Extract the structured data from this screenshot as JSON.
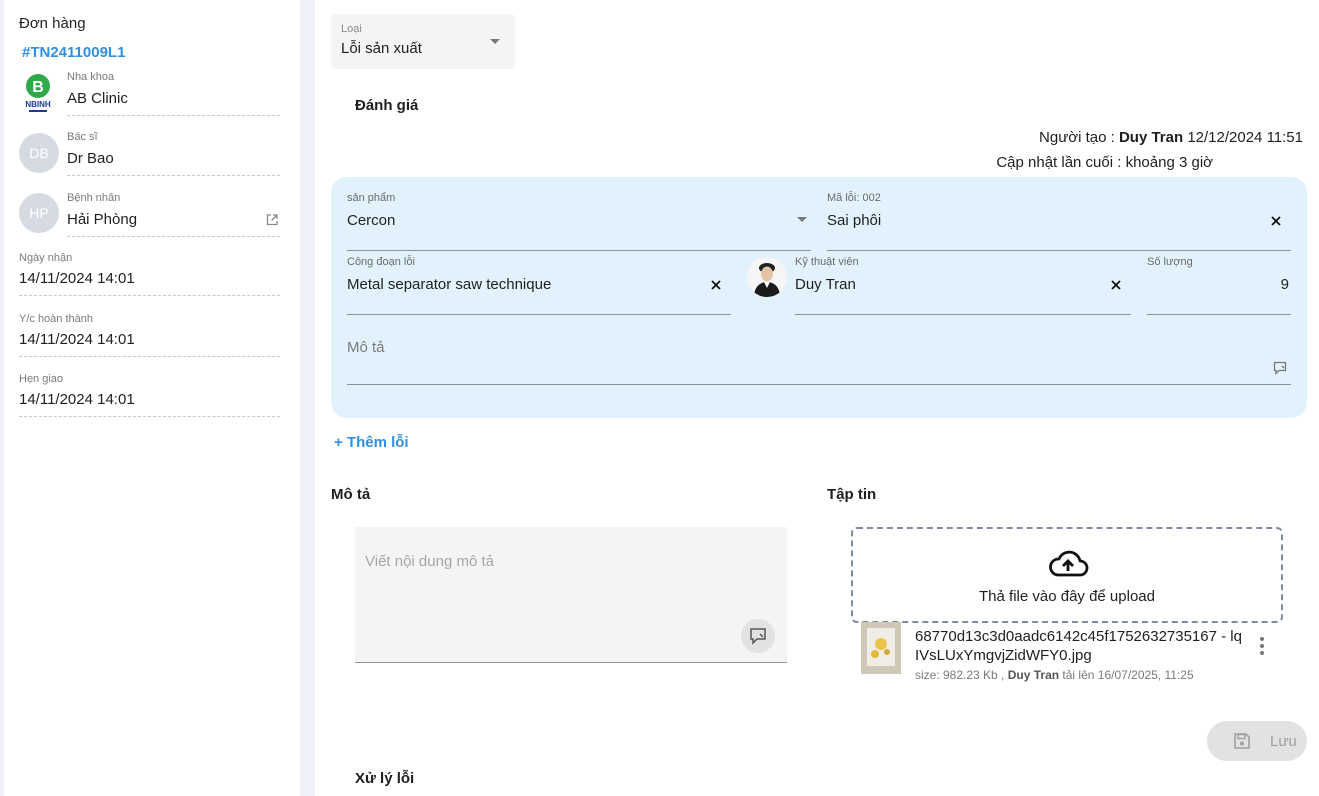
{
  "sidebar": {
    "title": "Đơn hàng",
    "order_code": "#TN2411009L1",
    "clinic_label": "Nha khoa",
    "clinic_name": "AB Clinic",
    "doctor_label": "Bác sĩ",
    "doctor_initials": "DB",
    "doctor_name": "Dr Bao",
    "patient_label": "Bệnh nhân",
    "patient_initials": "HP",
    "patient_name": "Hải Phòng",
    "received_label": "Ngày nhận",
    "received_value": "14/11/2024 14:01",
    "due_label": "Y/c hoàn thành",
    "due_value": "14/11/2024 14:01",
    "delivery_label": "Hẹn giao",
    "delivery_value": "14/11/2024 14:01"
  },
  "type_select": {
    "label": "Loại",
    "value": "Lỗi sản xuất"
  },
  "evaluation": {
    "title": "Đánh giá",
    "creator_prefix": "Người tạo : ",
    "creator_name": "Duy Tran",
    "created_at": "12/12/2024 11:51",
    "updated_prefix": "Cập nhật lần cuối : ",
    "updated_value": "khoảng 3 giờ"
  },
  "defect": {
    "product_label": "sản phẩm",
    "product_value": "Cercon",
    "error_code_label": "Mã lỗi: 002",
    "error_code_value": "Sai phôi",
    "stage_label": "Công đoạn lỗi",
    "stage_value": "Metal separator saw technique",
    "technician_label": "Kỹ thuật viên",
    "technician_value": "Duy Tran",
    "quantity_label": "Số lượng",
    "quantity_value": "9",
    "description_placeholder": "Mô tả"
  },
  "add_error_label": "+ Thêm lỗi",
  "description": {
    "title": "Mô tả",
    "placeholder": "Viết nội dung mô tả"
  },
  "files": {
    "title": "Tập tin",
    "dropzone_text": "Thả file vào đây để upload",
    "items": [
      {
        "name": "68770d13c3d0aadc6142c45f1752632735167 - lqIVsLUxYmgvjZidWFY0.jpg",
        "size_prefix": "size: 982.23 Kb , ",
        "uploader": "Duy Tran",
        "upload_suffix": " tải lên 16/07/2025, 11:25"
      }
    ]
  },
  "save_label": "Lưu",
  "handling": {
    "title": "Xử lý lỗi"
  },
  "colors": {
    "accent": "#2f8fe0",
    "card_bg": "#e1f2fd",
    "gutter": "#eef2f8"
  }
}
